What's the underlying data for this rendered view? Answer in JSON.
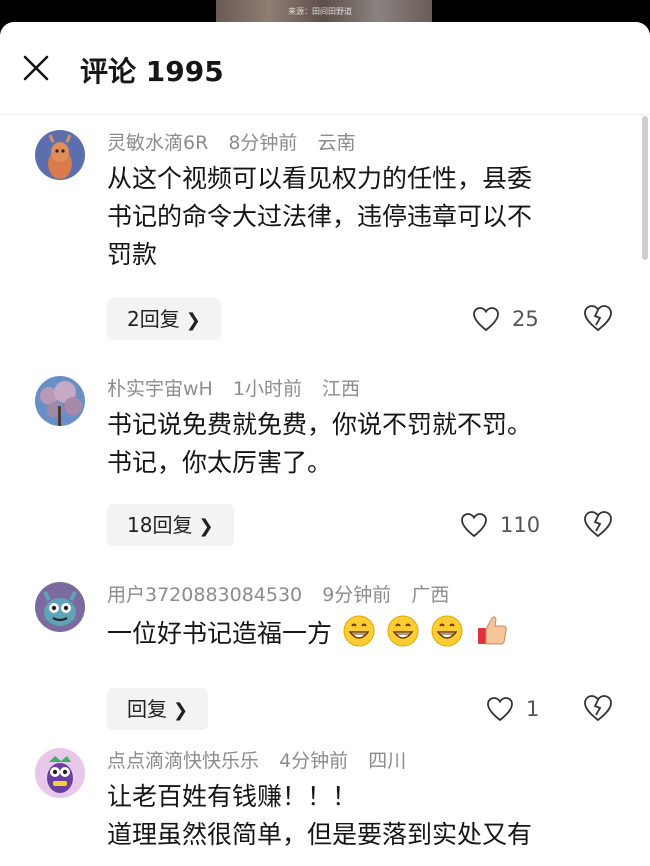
{
  "video": {
    "caption": "来源：田间田野道"
  },
  "header": {
    "title": "评论 1995"
  },
  "comments": [
    {
      "username": "灵敏水滴6R",
      "time": "8分钟前",
      "location": "云南",
      "lines": [
        "从这个视频可以看见权力的任性，县委",
        "书记的命令大过法律，违停违章可以不",
        "罚款"
      ],
      "reply_label": "2回复",
      "likes": "25"
    },
    {
      "username": "朴实宇宙wH",
      "time": "1小时前",
      "location": "江西",
      "lines": [
        "书记说免费就免费，你说不罚就不罚。",
        "书记，你太厉害了。"
      ],
      "reply_label": "18回复",
      "likes": "110"
    },
    {
      "username": "用户3720883084530",
      "time": "9分钟前",
      "location": "广西",
      "lines": [
        "一位好书记造福一方"
      ],
      "emojis": [
        "grin-emoji",
        "grin-emoji",
        "grin-emoji",
        "thumbs-up-emoji"
      ],
      "reply_label": "回复",
      "likes": "1"
    },
    {
      "username": "点点滴滴快快乐乐",
      "time": "4分钟前",
      "location": "四川",
      "lines": [
        "让老百姓有钱赚！！！",
        "道理虽然很简单，但是要落到实处又有"
      ]
    }
  ],
  "icons": {
    "close": "close-icon",
    "like": "heart-outline-icon",
    "dislike": "broken-heart-icon",
    "reply_chevron": "chevron-right-icon"
  },
  "colors": {
    "text_primary": "#151515",
    "text_meta": "#8c8c8c",
    "reply_bg": "#f3f3f3"
  }
}
